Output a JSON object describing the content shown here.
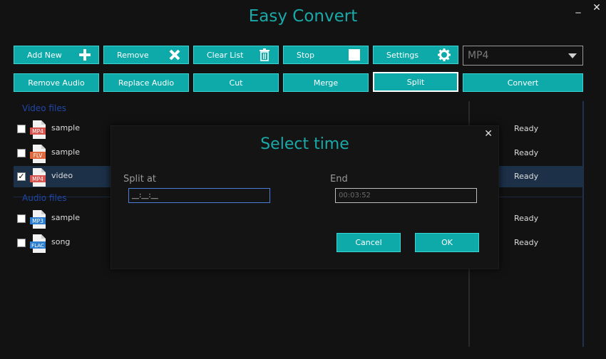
{
  "app": {
    "title": "Easy Convert"
  },
  "window": {
    "minimize": "_",
    "close": "✕"
  },
  "toolbar": {
    "add_new": "Add New",
    "remove": "Remove",
    "clear_list": "Clear List",
    "stop": "Stop",
    "settings": "Settings",
    "format": "MP4",
    "remove_audio": "Remove Audio",
    "replace_audio": "Replace Audio",
    "cut": "Cut",
    "merge": "Merge",
    "split": "Split",
    "convert": "Convert"
  },
  "files": {
    "video_header": "Video files",
    "audio_header": "Audio files",
    "video": [
      {
        "name": "sample",
        "format": "MP4",
        "status": "Ready",
        "checked": false,
        "color": "#d9534f"
      },
      {
        "name": "sample",
        "format": "FLV",
        "status": "Ready",
        "checked": false,
        "color": "#e0683a"
      },
      {
        "name": "video",
        "format": "MP4",
        "status": "Ready",
        "checked": true,
        "color": "#d9534f"
      }
    ],
    "audio": [
      {
        "name": "sample",
        "format": "MP3",
        "status": "Ready",
        "checked": false,
        "color": "#2f7fd0"
      },
      {
        "name": "song",
        "format": "FLAC",
        "status": "Ready",
        "checked": false,
        "color": "#2f7fd0"
      }
    ]
  },
  "dialog": {
    "title": "Select time",
    "close": "✕",
    "split_label": "Split at",
    "split_value": "__:__:__",
    "end_label": "End",
    "end_value": "00:03:52",
    "cancel": "Cancel",
    "ok": "OK"
  },
  "colors": {
    "accent": "#0eaaaa",
    "title": "#1aa9a9",
    "section": "#1f47a8",
    "selected_row": "#1c3048"
  }
}
